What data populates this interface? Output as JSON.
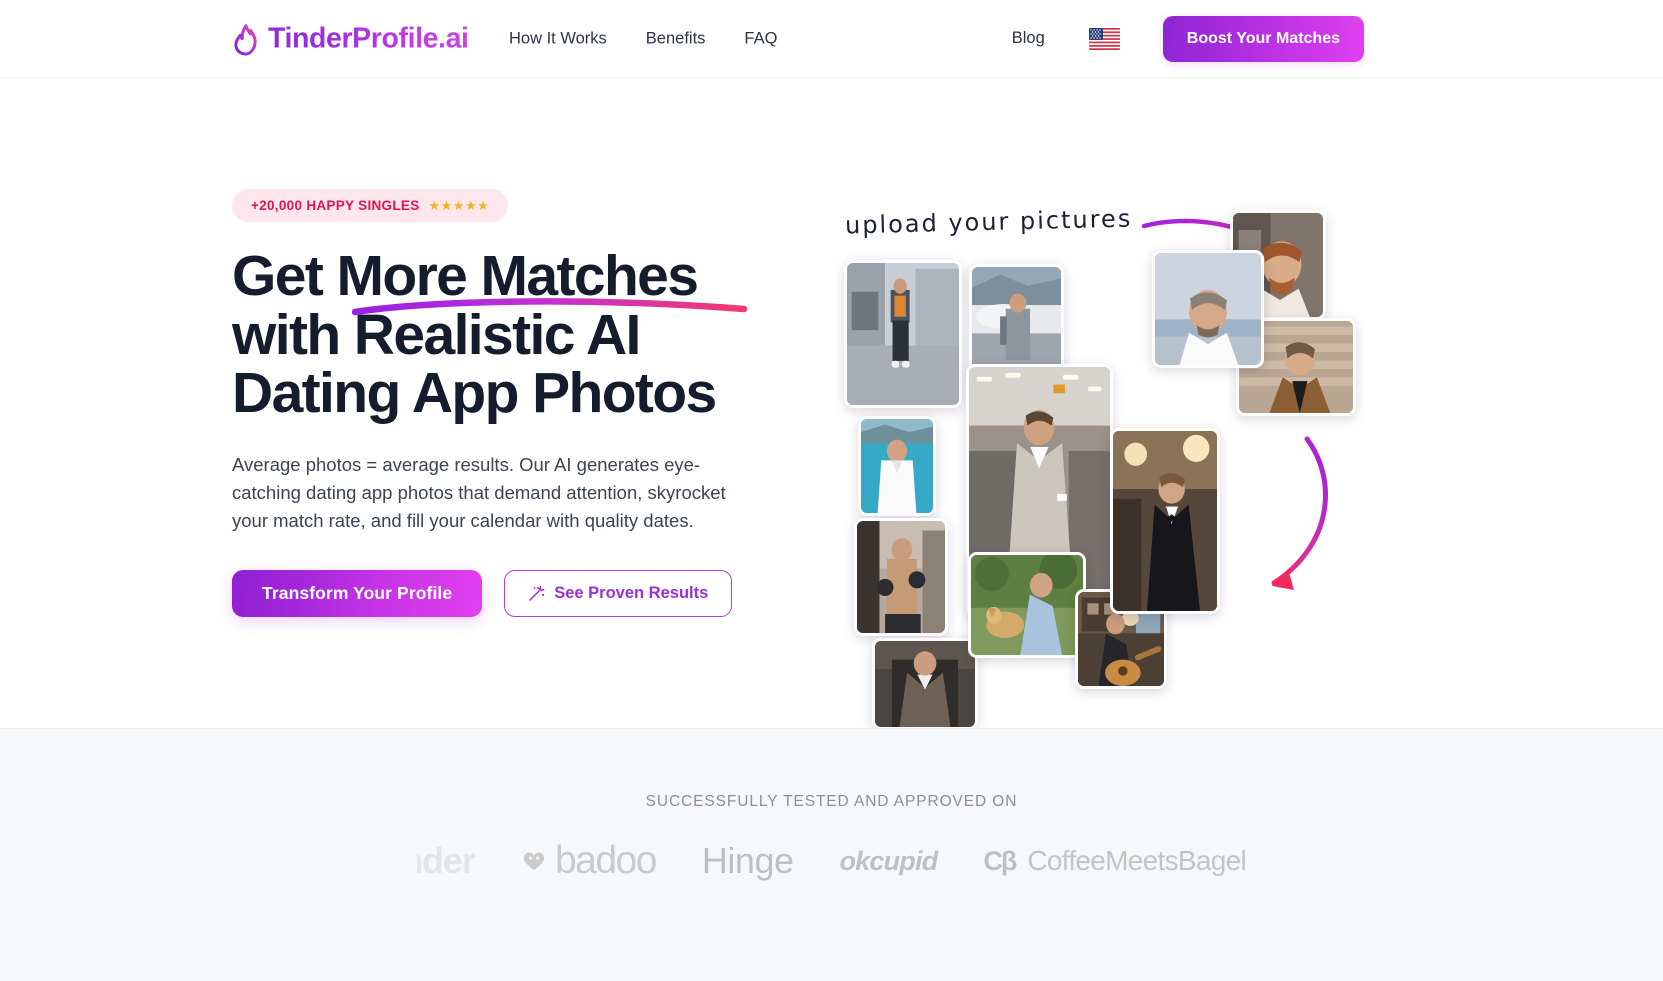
{
  "header": {
    "brand": "TinderProfile.ai",
    "brand_icon": "flame-icon",
    "nav": [
      {
        "label": "How It Works"
      },
      {
        "label": "Benefits"
      },
      {
        "label": "FAQ"
      }
    ],
    "blog_label": "Blog",
    "language_flag": "us-flag-icon",
    "cta_label": "Boost Your Matches"
  },
  "hero": {
    "badge": {
      "text": "+20,000 HAPPY SINGLES",
      "stars": "★★★★★"
    },
    "headline_line1_a": "Get ",
    "headline_line1_b": "More Matches",
    "headline_line2": "with Realistic AI",
    "headline_line3": "Dating App Photos",
    "subtext": "Average photos = average results. Our AI generates eye-catching dating app photos that demand attention, skyrocket your match rate, and fill your calendar with quality dates.",
    "primary_cta": "Transform Your Profile",
    "secondary_cta": "See Proven Results",
    "secondary_icon": "magic-wand-icon",
    "annotation": "upload your pictures"
  },
  "social_proof": {
    "title": "SUCCESSFULLY TESTED AND APPROVED ON",
    "logos": [
      {
        "name": "tinder",
        "label": "Tinder"
      },
      {
        "name": "badoo",
        "label": "badoo"
      },
      {
        "name": "hinge",
        "label": "Hinge"
      },
      {
        "name": "okcupid",
        "label": "okcupid"
      },
      {
        "name": "coffeemeetsbagel",
        "label": "CoffeeMeetsBagel",
        "mark": "Cβ"
      }
    ]
  },
  "colors": {
    "brand_purple": "#9b2ed8",
    "brand_pink": "#e040ef",
    "badge_bg": "#fde6ec",
    "badge_text": "#e0154f",
    "star": "#f0b429",
    "heading": "#141c2e",
    "body_text": "#3b4454",
    "section_bg": "#f7f8fa"
  }
}
